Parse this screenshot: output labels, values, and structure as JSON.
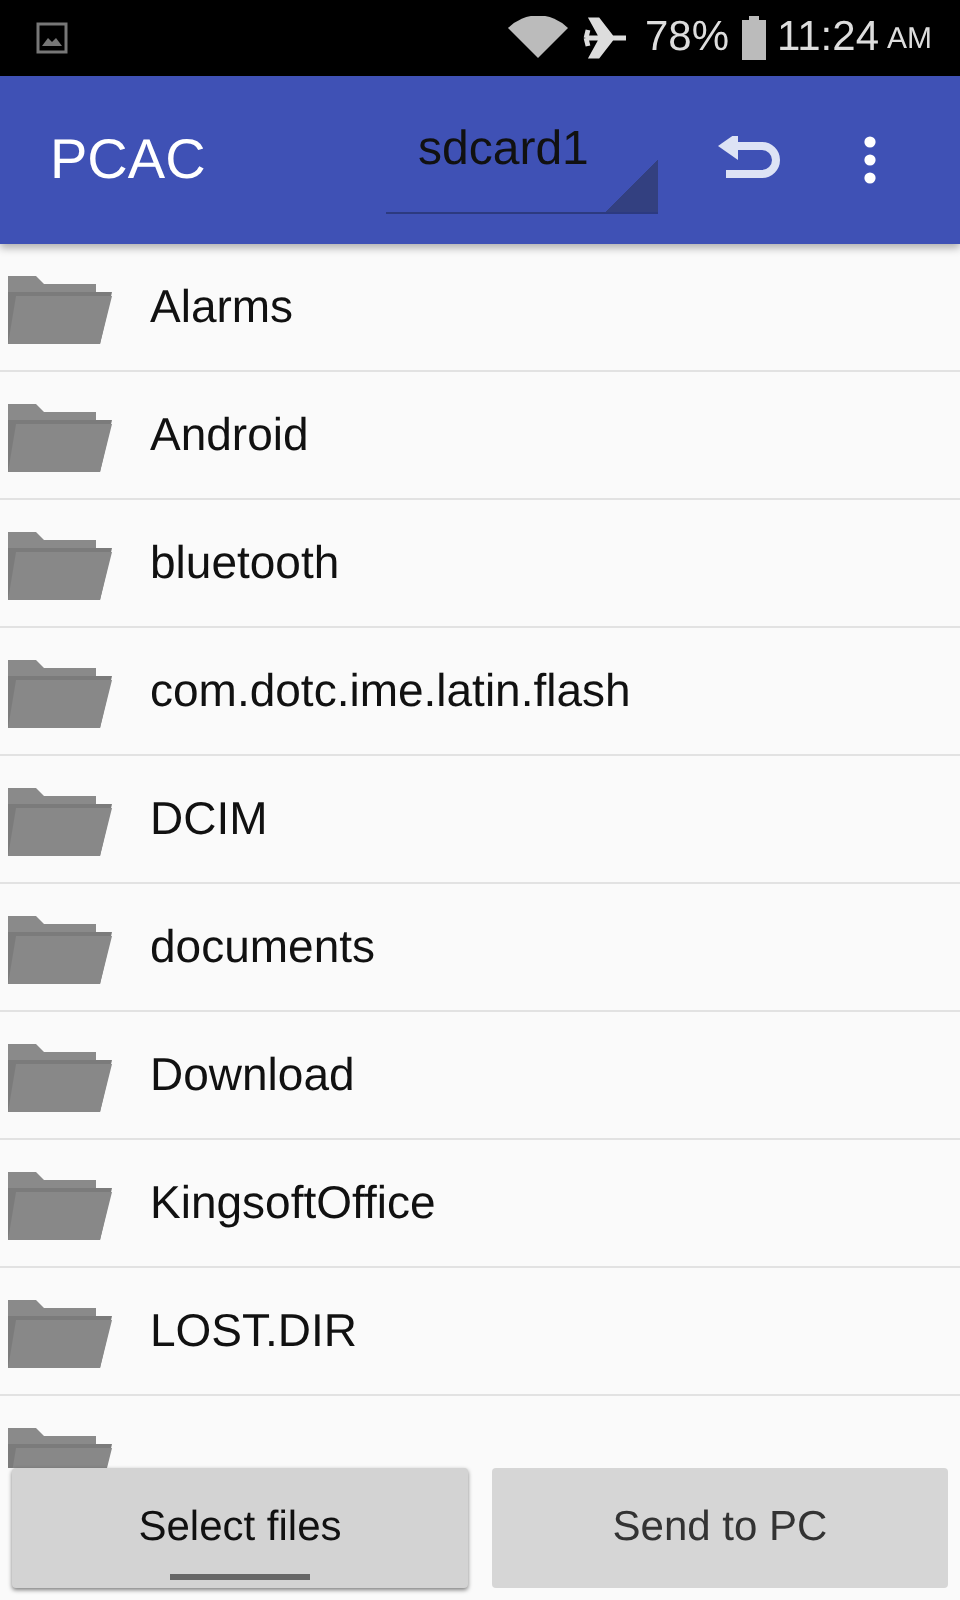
{
  "status_bar": {
    "battery": "78%",
    "time": "11:24",
    "ampm": "AM"
  },
  "app_bar": {
    "title": "PCAC",
    "dropdown": {
      "value": "sdcard1"
    }
  },
  "folders": [
    {
      "name": "Alarms"
    },
    {
      "name": "Android"
    },
    {
      "name": "bluetooth"
    },
    {
      "name": "com.dotc.ime.latin.flash"
    },
    {
      "name": "DCIM"
    },
    {
      "name": "documents"
    },
    {
      "name": "Download"
    },
    {
      "name": "KingsoftOffice"
    },
    {
      "name": "LOST.DIR"
    }
  ],
  "partial_row": true,
  "buttons": [
    {
      "label": "Select files",
      "selected": true
    },
    {
      "label": "Send to PC",
      "selected": false
    }
  ]
}
